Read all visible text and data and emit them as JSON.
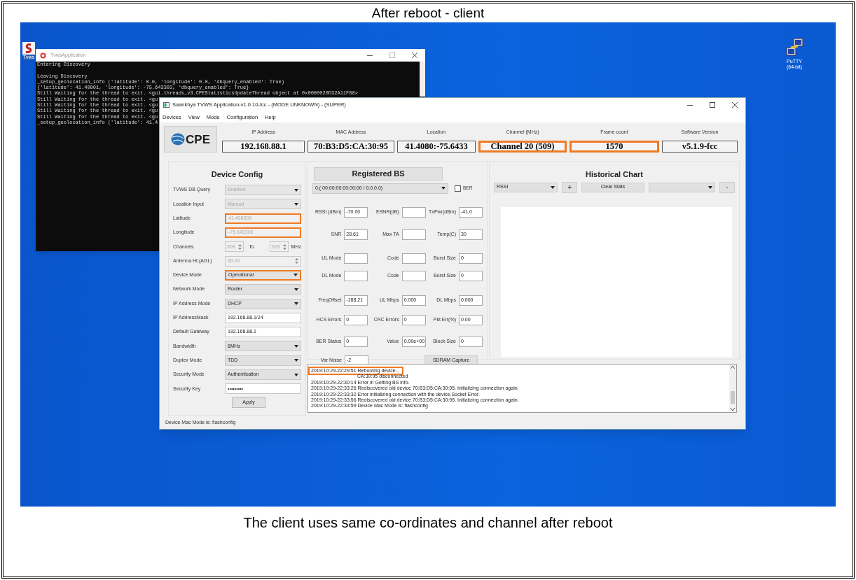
{
  "page_title": "After reboot - client",
  "desktop_icons": [
    {
      "label": "Tvws"
    },
    {
      "label": "PuTTY (64-bit)"
    }
  ],
  "console": {
    "title": "TvwsApplication",
    "lines": [
      {
        "text": "Entering Discovery",
        "gap_before": false
      },
      {
        "text": "Leaving Discovery",
        "gap_before": true
      },
      {
        "text": "_setup_geolocation_info ('latitude': 0.0, 'longitude': 0.0, 'dbquery_enabled': True)",
        "gap_before": false
      },
      {
        "text": "{'latitude': 41.40801, 'longitude': -75.643303, 'dbquery_enabled': True}",
        "gap_before": false
      },
      {
        "text": "Still Waiting for the thread to exit. <gui.threads_v3.CPEStatisticsUpdateThread object at 0x0000020D32A11F88>",
        "gap_before": false
      },
      {
        "text": "Still Waiting for the thread to exit. <gu",
        "gap_before": false
      },
      {
        "text": "Still Waiting for the thread to exit. <gu",
        "gap_before": false
      },
      {
        "text": "Still Waiting for the thread to exit. <gu",
        "gap_before": false
      },
      {
        "text": "Still Waiting for the thread to exit. <gu",
        "gap_before": false
      },
      {
        "text": "_setup_geolocation_info ('latitude': 41.4",
        "gap_before": false
      }
    ]
  },
  "main_window": {
    "title": "Saankhya TVWS Application-v1.0.10-fcc - (MODE UNKNOWN) - (SUPER)",
    "menu": [
      "Devices",
      "View",
      "Mode",
      "Configuration",
      "Help"
    ],
    "logo": "CPE",
    "info": [
      {
        "label": "IP Address",
        "value": "192.168.88.1",
        "highlighted": false
      },
      {
        "label": "MAC Address",
        "value": "70:B3:D5:CA:30:95",
        "highlighted": false
      },
      {
        "label": "Location",
        "value": "41.4080:-75.6433",
        "highlighted": false
      },
      {
        "label": "Channel (MHz)",
        "value": "Channel 20 (509)",
        "highlighted": true
      },
      {
        "label": "Frame count",
        "value": "1570",
        "highlighted": true
      },
      {
        "label": "Software Version",
        "value": "v5.1.9-fcc",
        "highlighted": false
      }
    ],
    "device_config": {
      "title": "Device Config",
      "fields": [
        {
          "label": "TVWS DB Query",
          "kind": "select",
          "value": "Enabled",
          "disabled": true,
          "highlighted": false
        },
        {
          "label": "Location Input",
          "kind": "select",
          "value": "Manual",
          "disabled": true,
          "highlighted": false
        },
        {
          "label": "Latitude",
          "kind": "text",
          "value": "41.408009",
          "disabled": true,
          "highlighted": true
        },
        {
          "label": "Longitude",
          "kind": "text",
          "value": "-75.643303",
          "disabled": true,
          "highlighted": true
        },
        {
          "label": "Channels",
          "kind": "range",
          "values": [
            "509",
            "509"
          ],
          "to_label": "To",
          "unit": "MHz",
          "disabled": true,
          "highlighted": false
        },
        {
          "label": "Antenna Ht.(AGL)",
          "kind": "spin",
          "value": "30.00",
          "disabled": true,
          "highlighted": false
        },
        {
          "label": "Device Mode",
          "kind": "select",
          "value": "Operational",
          "disabled": false,
          "highlighted": true
        },
        {
          "label": "Network Mode",
          "kind": "select",
          "value": "Router",
          "disabled": false,
          "highlighted": false
        },
        {
          "label": "IP Address Mode",
          "kind": "select",
          "value": "DHCP",
          "disabled": false,
          "highlighted": false
        },
        {
          "label": "IP AddressMask",
          "kind": "text",
          "value": "192.168.88.1/24",
          "disabled": false,
          "highlighted": false
        },
        {
          "label": "Default Gateway",
          "kind": "text",
          "value": "192.168.88.1",
          "disabled": false,
          "highlighted": false
        },
        {
          "label": "Bandwidth",
          "kind": "select",
          "value": "6MHz",
          "disabled": false,
          "highlighted": false
        },
        {
          "label": "Duplex Mode",
          "kind": "select",
          "value": "TDD",
          "disabled": false,
          "highlighted": false
        },
        {
          "label": "Security Mode",
          "kind": "select",
          "value": "Authentication",
          "disabled": false,
          "highlighted": false
        },
        {
          "label": "Security Key",
          "kind": "text",
          "value": "•••••••••",
          "disabled": false,
          "highlighted": false
        }
      ],
      "apply": "Apply"
    },
    "registered_bs": {
      "title": "Registered BS",
      "select": "0:( 00:00:00:00:00:00 / 0.0.0.0)",
      "checkbox": {
        "label": "BER",
        "checked": false
      },
      "rows": [
        [
          {
            "label": "RSSI (dBm)",
            "value": "-70.00"
          },
          {
            "label": "ESNR(dB)"
          },
          {
            "label": "TxPwr(dBm)",
            "value": "-41.0"
          }
        ],
        [
          {
            "label": "SNR",
            "value": "28.61"
          },
          {
            "label": "Max TA"
          },
          {
            "label": "Temp(C)",
            "value": "30"
          }
        ],
        [
          {
            "label": "UL Mode"
          },
          {
            "label": "Code"
          },
          {
            "label": "Burst Size",
            "value": "0"
          }
        ],
        [
          {
            "label": "DL Mode"
          },
          {
            "label": "Code"
          },
          {
            "label": "Burst Size",
            "value": "0"
          }
        ],
        [
          {
            "label": "FreqOffset",
            "value": "-188.21"
          },
          {
            "label": "UL Mbps",
            "value": "0.000"
          },
          {
            "label": "DL Mbps",
            "value": "0.000"
          }
        ],
        [
          {
            "label": "HCS Errors",
            "value": "0"
          },
          {
            "label": "CRC Errors",
            "value": "0"
          },
          {
            "label": "Pkt Err(%)",
            "value": "0.00"
          }
        ],
        [
          {
            "label": "BER Status",
            "value": "0"
          },
          {
            "label": "Value",
            "value": "0.00e+00"
          },
          {
            "label": "Block Size",
            "value": "0"
          }
        ],
        [
          {
            "label": "Var Noise",
            "value": "-2"
          }
        ]
      ],
      "capture_button": "SDRAM Capture"
    },
    "historical_chart": {
      "title": "Historical Chart",
      "metric_select": "RSSI",
      "add_button": "+",
      "clear_button": "Clear Stats",
      "remove_button": "-"
    },
    "log": [
      {
        "text": "2019:10:29-22:29:51 Rebooting device...",
        "highlighted": true,
        "kind": "full"
      },
      {
        "text": "CA:30:95 disconnected",
        "highlighted": false,
        "kind": "obscured"
      },
      {
        "text": "2019:10:29-22:30:14 Error in Getting BS info.",
        "highlighted": false,
        "kind": "full"
      },
      {
        "text": "2019:10:29-22:33:26 Rediscovered old device 70:B3:D5:CA:30:95. Initializing connection again.",
        "highlighted": false,
        "kind": "full"
      },
      {
        "text": "2019:10:29-22:33:32 Error initializing connection with the device.Socket Error.",
        "highlighted": false,
        "kind": "full"
      },
      {
        "text": "2019:10:29-22:33:56 Rediscovered old device 70:B3:D5:CA:30:95. Initializing connection again.",
        "highlighted": false,
        "kind": "full"
      },
      {
        "text": "2019:10:29-22:33:59 Device Mac Mode is: flashconfig",
        "highlighted": false,
        "kind": "full"
      }
    ],
    "status_bar": "Device Mac Mode is: flashconfig"
  },
  "caption": "The client uses same co-ordinates and channel after reboot"
}
